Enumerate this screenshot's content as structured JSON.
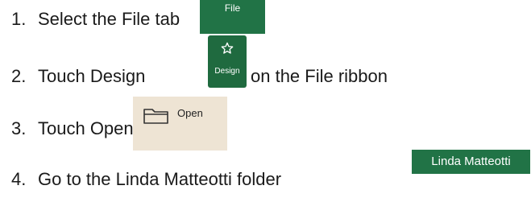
{
  "steps": [
    {
      "num": "1.",
      "text": "Select the File tab"
    },
    {
      "num": "2.",
      "text_before": "Touch Design",
      "text_after": "on the File ribbon"
    },
    {
      "num": "3.",
      "text": "Touch Open"
    },
    {
      "num": "4.",
      "text": "Go to the Linda Matteotti folder"
    }
  ],
  "buttons": {
    "file": {
      "label": "File",
      "bg": "#217346"
    },
    "design": {
      "label": "Design",
      "icon": "star-outline-icon",
      "bg": "#1f6a3f"
    },
    "open": {
      "label": "Open",
      "icon": "folder-outline-icon",
      "bg": "#eee4d4"
    },
    "folder": {
      "label": "Linda Matteotti",
      "bg": "#217346"
    }
  }
}
